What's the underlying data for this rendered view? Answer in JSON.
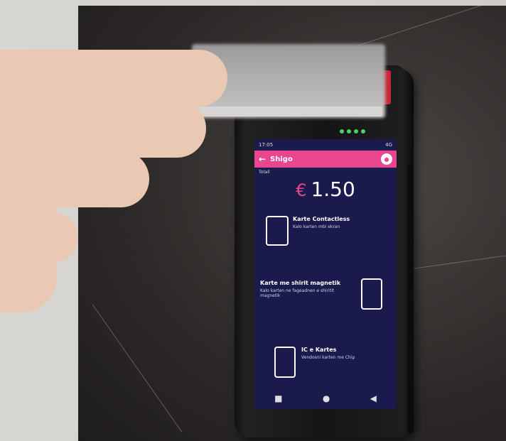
{
  "status": {
    "time": "17:05",
    "right": "4G"
  },
  "appbar": {
    "back": "←",
    "title": "Shigo"
  },
  "total": {
    "label": "Totali",
    "currency": "€",
    "value": "1.50"
  },
  "options": [
    {
      "title": "Karte Contactless",
      "subtitle": "Kalo karten mbi ekran"
    },
    {
      "title": "Karte me shirit magnetik",
      "subtitle": "Kalo karten ne fageadnen e shiritit magnetik"
    },
    {
      "title": "IC e Kartes",
      "subtitle": "Vendosni karten me Chip"
    }
  ],
  "nav": {
    "recent": "■",
    "home": "●",
    "back": "◀"
  },
  "colors": {
    "accent": "#e8478f",
    "screen_bg": "#1a1a4d"
  }
}
